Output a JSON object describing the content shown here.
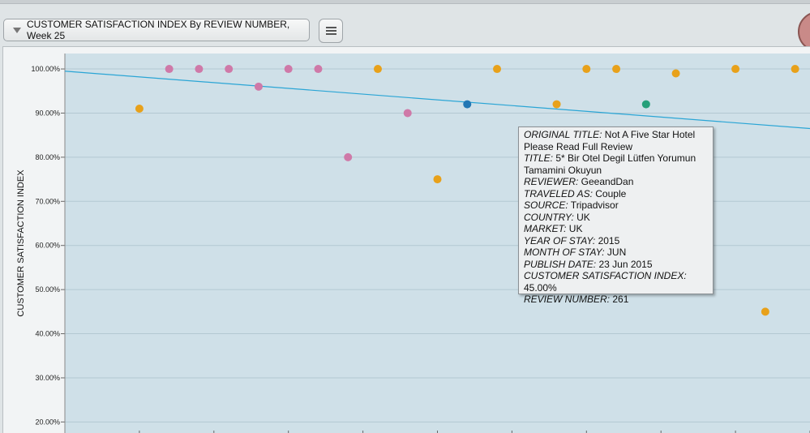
{
  "header": {
    "chart_title_button": "CUSTOMER SATISFACTION INDEX By REVIEW NUMBER, Week 25",
    "menu_icon": "hamburger-menu-icon",
    "dropdown_icon": "triangle-down-icon"
  },
  "colors": {
    "plot_background": "#cfe0e8",
    "trendline": "#2aa5d5",
    "series": [
      "#e8a11a",
      "#cf79a8",
      "#2277b4",
      "#26a07a"
    ]
  },
  "chart_data": {
    "type": "scatter",
    "ylabel": "CUSTOMER SATISFACTION INDEX",
    "xlabel": "",
    "ylim": [
      17.5,
      103.5
    ],
    "xlim": [
      0,
      25
    ],
    "yticks": [
      "100.00%",
      "90.00%",
      "80.00%",
      "70.00%",
      "60.00%",
      "50.00%",
      "40.00%",
      "30.00%",
      "20.00%"
    ],
    "grid": true,
    "points": [
      {
        "x": 2.5,
        "y": 91,
        "color": "#e8a11a"
      },
      {
        "x": 3.5,
        "y": 100,
        "color": "#cf79a8"
      },
      {
        "x": 4.5,
        "y": 100,
        "color": "#cf79a8"
      },
      {
        "x": 5.5,
        "y": 100,
        "color": "#cf79a8"
      },
      {
        "x": 6.5,
        "y": 96,
        "color": "#cf79a8"
      },
      {
        "x": 7.5,
        "y": 100,
        "color": "#cf79a8"
      },
      {
        "x": 8.5,
        "y": 100,
        "color": "#cf79a8"
      },
      {
        "x": 9.5,
        "y": 80,
        "color": "#cf79a8"
      },
      {
        "x": 10.5,
        "y": 100,
        "color": "#e8a11a"
      },
      {
        "x": 11.5,
        "y": 90,
        "color": "#cf79a8"
      },
      {
        "x": 12.5,
        "y": 75,
        "color": "#e8a11a"
      },
      {
        "x": 13.5,
        "y": 92,
        "color": "#2277b4"
      },
      {
        "x": 14.5,
        "y": 100,
        "color": "#e8a11a"
      },
      {
        "x": 16.5,
        "y": 92,
        "color": "#e8a11a"
      },
      {
        "x": 17.5,
        "y": 100,
        "color": "#e8a11a"
      },
      {
        "x": 18.5,
        "y": 100,
        "color": "#e8a11a"
      },
      {
        "x": 19.5,
        "y": 92,
        "color": "#26a07a"
      },
      {
        "x": 20.5,
        "y": 99,
        "color": "#e8a11a"
      },
      {
        "x": 22.5,
        "y": 100,
        "color": "#e8a11a"
      },
      {
        "x": 23.5,
        "y": 45,
        "color": "#e8a11a"
      },
      {
        "x": 24.5,
        "y": 100,
        "color": "#e8a11a"
      }
    ],
    "trendline": {
      "x0": 0,
      "y0": 99.5,
      "x1": 25,
      "y1": 86.5
    }
  },
  "tooltip": {
    "rows": [
      {
        "key": "ORIGINAL TITLE:",
        "value": " Not A Five Star Hotel Please Read Full Review"
      },
      {
        "key": "TITLE:",
        "value": " 5* Bir Otel Degil Lütfen Yorumun Tamamini Okuyun"
      },
      {
        "key": "REVIEWER:",
        "value": " GeeandDan"
      },
      {
        "key": "TRAVELED AS:",
        "value": " Couple"
      },
      {
        "key": "SOURCE:",
        "value": " Tripadvisor"
      },
      {
        "key": "COUNTRY:",
        "value": " UK"
      },
      {
        "key": "MARKET:",
        "value": " UK"
      },
      {
        "key": "YEAR OF STAY:",
        "value": " 2015"
      },
      {
        "key": "MONTH OF STAY:",
        "value": " JUN"
      },
      {
        "key": "PUBLISH DATE:",
        "value": " 23 Jun 2015"
      },
      {
        "key": "CUSTOMER SATISFACTION INDEX:",
        "value": " 45.00%"
      },
      {
        "key": "REVIEW NUMBER:",
        "value": " 261"
      }
    ]
  }
}
